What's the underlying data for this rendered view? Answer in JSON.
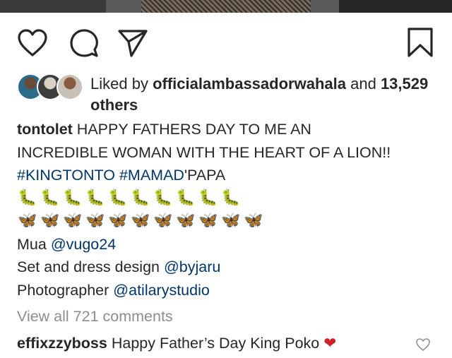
{
  "post": {
    "actions": {
      "like": "heart-icon",
      "comment": "comment-icon",
      "share": "share-icon",
      "save": "bookmark-icon"
    },
    "likes": {
      "prefix": "Liked by",
      "user": "officialambassadorwahala",
      "joiner": "and",
      "others": "13,529 others"
    },
    "caption": {
      "username": "tontolet",
      "line1": "HAPPY FATHERS DAY TO ME AN",
      "line2": "INCREDIBLE WOMAN WITH THE HEART OF A LION!!",
      "hashtag1": "#KINGTONTO",
      "hashtag2": "#MAMAD",
      "hashtag2_suffix": "'PAPA",
      "caterpillar_emoji": "🐛",
      "caterpillar_count": 10,
      "butterfly_emoji": "🦋",
      "butterfly_count": 11,
      "credits": [
        {
          "label": "Mua",
          "handle": "@vugo24"
        },
        {
          "label": "Set and dress design",
          "handle": "@byjaru"
        },
        {
          "label": "Photographer",
          "handle": "@atilarystudio"
        }
      ]
    },
    "view_all_comments": "View all 721 comments",
    "comment": {
      "username": "effixzzyboss",
      "text": "Happy Father’s Day King Poko",
      "emoji": "❤"
    }
  }
}
